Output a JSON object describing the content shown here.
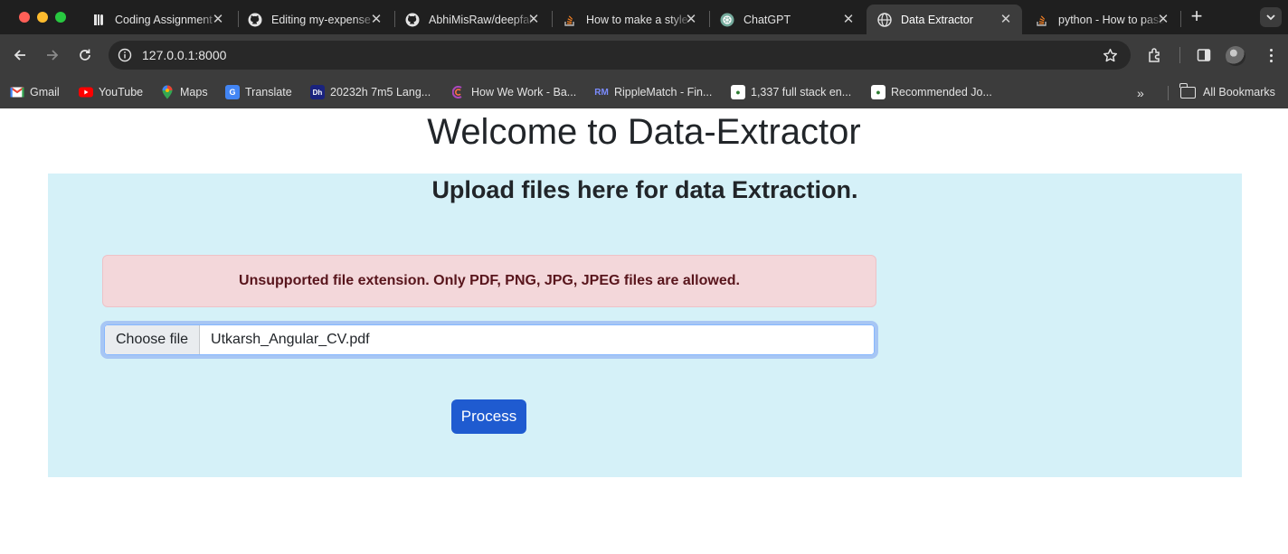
{
  "browser": {
    "tabs": [
      {
        "title": "Coding Assignment",
        "icon": "stripe-like-icon",
        "active": false
      },
      {
        "title": "Editing my-expense",
        "icon": "github-icon",
        "active": false
      },
      {
        "title": "AbhiMisRaw/deepfake",
        "icon": "github-icon",
        "active": false
      },
      {
        "title": "How to make a style",
        "icon": "stackoverflow-icon",
        "active": false
      },
      {
        "title": "ChatGPT",
        "icon": "chatgpt-icon",
        "active": false
      },
      {
        "title": "Data Extractor",
        "icon": "globe-icon",
        "active": true
      },
      {
        "title": "python - How to pass",
        "icon": "stackoverflow-icon",
        "active": false
      }
    ],
    "new_tab_label": "+",
    "url": "127.0.0.1:8000",
    "bookmarks": [
      {
        "label": "Gmail",
        "icon": "gmail-icon",
        "color": "#ea4335"
      },
      {
        "label": "YouTube",
        "icon": "youtube-icon",
        "color": "#ff0000"
      },
      {
        "label": "Maps",
        "icon": "maps-pin-icon",
        "color": "#34a853"
      },
      {
        "label": "Translate",
        "icon": "translate-icon",
        "color": "#4285f4"
      },
      {
        "label": "20232h 7m5 Lang...",
        "icon": "dh-icon",
        "color": "#1a237e"
      },
      {
        "label": "How We Work - Ba...",
        "icon": "swirl-icon",
        "color": "#ab47bc"
      },
      {
        "label": "RippleMatch - Fin...",
        "icon": "ripplematch-icon",
        "color": "#5b6cf0"
      },
      {
        "label": "1,337 full stack en...",
        "icon": "jobs-icon",
        "color": "#2e7d32"
      },
      {
        "label": "Recommended Jo...",
        "icon": "jobs-icon",
        "color": "#2e7d32"
      }
    ],
    "more_bookmarks": "»",
    "all_bookmarks": "All Bookmarks"
  },
  "page": {
    "title": "Welcome to Data-Extractor",
    "upload_heading": "Upload files here for data Extraction.",
    "error_message": "Unsupported file extension. Only PDF, PNG, JPG, JPEG files are allowed.",
    "file_button": "Choose file",
    "file_name": "Utkarsh_Angular_CV.pdf",
    "process_button": "Process"
  }
}
